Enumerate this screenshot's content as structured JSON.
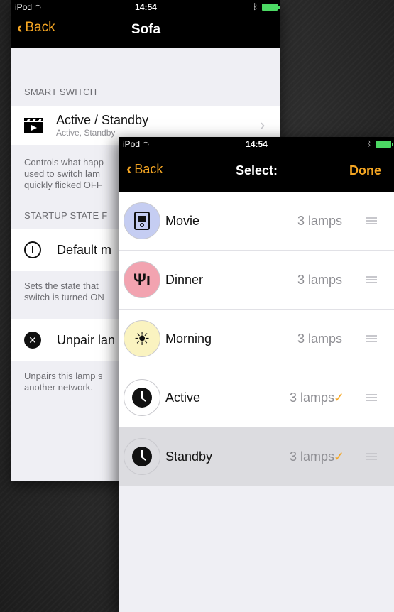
{
  "back_screen": {
    "status": {
      "carrier": "iPod",
      "time": "14:54"
    },
    "nav": {
      "back_label": "Back",
      "title": "Sofa"
    },
    "smart_switch": {
      "header": "SMART SWITCH",
      "cell_title": "Active / Standby",
      "cell_subtitle": "Active, Standby",
      "footer_lines": [
        "Controls what happ",
        "used to switch lam",
        "quickly flicked OFF"
      ]
    },
    "startup": {
      "header": "STARTUP STATE F",
      "cell_title": "Default m",
      "footer_lines": [
        "Sets the state that",
        "switch is turned ON"
      ]
    },
    "unpair": {
      "cell_title": "Unpair lan",
      "footer_lines": [
        "Unpairs this lamp s",
        "another network."
      ]
    }
  },
  "front_screen": {
    "status": {
      "carrier": "iPod",
      "time": "14:54"
    },
    "nav": {
      "back_label": "Back",
      "title": "Select:",
      "done_label": "Done"
    },
    "scenes": [
      {
        "name": "Movie",
        "count": "3 lamps",
        "checked": false,
        "icon": "tv-remote-icon",
        "icon_bg": "#c5cdf2"
      },
      {
        "name": "Dinner",
        "count": "3 lamps",
        "checked": false,
        "icon": "fork-knife-icon",
        "icon_bg": "#f2a3b0"
      },
      {
        "name": "Morning",
        "count": "3 lamps",
        "checked": false,
        "icon": "sun-icon",
        "icon_bg": "#faf3c0"
      },
      {
        "name": "Active",
        "count": "3 lamps",
        "checked": true,
        "icon": "clock-icon",
        "icon_bg": "#ffffff"
      },
      {
        "name": "Standby",
        "count": "3 lamps",
        "checked": true,
        "icon": "clock-icon",
        "icon_bg": "#ffffff"
      }
    ]
  },
  "colors": {
    "accent": "#f5a623",
    "battery": "#4cd964",
    "background_group": "#efeff4",
    "secondary_text": "#8e8e93"
  }
}
